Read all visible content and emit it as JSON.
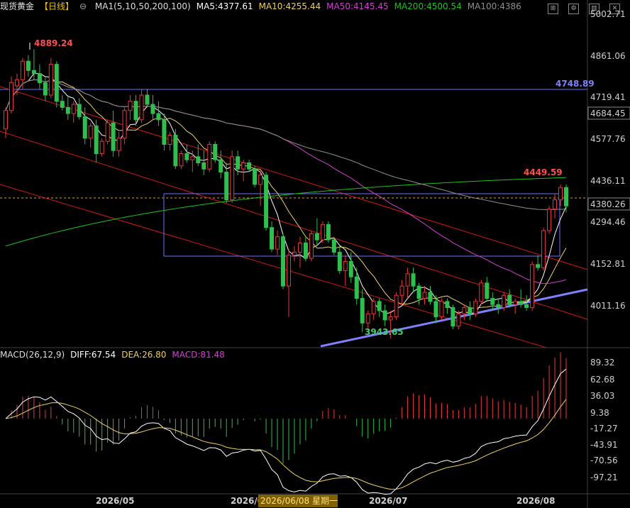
{
  "header": {
    "instrument": "现货黄金",
    "period": "【日线】",
    "ma_title": "MA1(5,10,50,200,100)",
    "ma5": "MA5:4377.61",
    "ma10": "MA10:4255.44",
    "ma50": "MA50:4145.45",
    "ma200": "MA200:4500.54",
    "ma100": "MA100:4386"
  },
  "macd_header": {
    "title": "MACD(26,12,9)",
    "diff": "DIFF:67.54",
    "dea": "DEA:26.80",
    "macd": "MACD:81.48"
  },
  "colors": {
    "up": "#e8383d",
    "down": "#2fbf4f",
    "ma5": "#ffffff",
    "ma10": "#f0d060",
    "ma50": "#d040d0",
    "ma200": "#20c020",
    "ma100": "#909090",
    "channel": "#d01818",
    "rect": "#7070ff",
    "support": "#8888ff"
  },
  "price_axis": {
    "ticks": [
      "5002.71",
      "4861.06",
      "4719.41",
      "4577.76",
      "4436.11",
      "4294.46",
      "4152.81",
      "4011.16"
    ],
    "last_price": "4380.26",
    "level_4684": "4684.45",
    "hline_value": "4748.89"
  },
  "annotations": {
    "high": "4889.24",
    "low": "3943.65",
    "recent_high": "4449.59"
  },
  "macd_axis": {
    "ticks": [
      "89.32",
      "62.68",
      "36.03",
      "9.38",
      "-17.27",
      "-43.91",
      "-70.56",
      "-97.21"
    ]
  },
  "x_axis": {
    "labels": [
      "2026/05",
      "2026/0",
      "2026/07",
      "2026/08"
    ],
    "cursor_label": "2026/06/08 星期一"
  },
  "chart_data": {
    "type": "candlestick",
    "ylim": [
      3920,
      5002.71
    ],
    "candles": [
      [
        4630,
        4700,
        4600,
        4690
      ],
      [
        4690,
        4800,
        4680,
        4780
      ],
      [
        4770,
        4810,
        4740,
        4790
      ],
      [
        4790,
        4860,
        4760,
        4850
      ],
      [
        4850,
        4870,
        4800,
        4820
      ],
      [
        4820,
        4889.24,
        4790,
        4810
      ],
      [
        4810,
        4840,
        4760,
        4780
      ],
      [
        4780,
        4800,
        4720,
        4740
      ],
      [
        4740,
        4860,
        4730,
        4840
      ],
      [
        4840,
        4850,
        4700,
        4720
      ],
      [
        4720,
        4740,
        4690,
        4700
      ],
      [
        4700,
        4740,
        4660,
        4680
      ],
      [
        4680,
        4720,
        4650,
        4710
      ],
      [
        4710,
        4730,
        4660,
        4670
      ],
      [
        4670,
        4700,
        4580,
        4600
      ],
      [
        4600,
        4650,
        4570,
        4640
      ],
      [
        4640,
        4660,
        4520,
        4550
      ],
      [
        4550,
        4600,
        4540,
        4590
      ],
      [
        4590,
        4660,
        4580,
        4650
      ],
      [
        4650,
        4690,
        4540,
        4560
      ],
      [
        4560,
        4620,
        4540,
        4600
      ],
      [
        4600,
        4700,
        4580,
        4690
      ],
      [
        4690,
        4740,
        4660,
        4720
      ],
      [
        4720,
        4740,
        4640,
        4660
      ],
      [
        4660,
        4760,
        4650,
        4740
      ],
      [
        4740,
        4760,
        4700,
        4710
      ],
      [
        4710,
        4740,
        4660,
        4680
      ],
      [
        4680,
        4720,
        4640,
        4660
      ],
      [
        4660,
        4680,
        4560,
        4580
      ],
      [
        4580,
        4620,
        4560,
        4610
      ],
      [
        4610,
        4630,
        4500,
        4510
      ],
      [
        4510,
        4560,
        4500,
        4550
      ],
      [
        4550,
        4580,
        4520,
        4530
      ],
      [
        4530,
        4560,
        4490,
        4540
      ],
      [
        4540,
        4580,
        4510,
        4520
      ],
      [
        4520,
        4560,
        4480,
        4500
      ],
      [
        4500,
        4590,
        4490,
        4580
      ],
      [
        4580,
        4590,
        4520,
        4530
      ],
      [
        4530,
        4560,
        4470,
        4490
      ],
      [
        4490,
        4520,
        4390,
        4400
      ],
      [
        4400,
        4560,
        4390,
        4540
      ],
      [
        4540,
        4560,
        4480,
        4500
      ],
      [
        4500,
        4530,
        4460,
        4520
      ],
      [
        4520,
        4530,
        4490,
        4500
      ],
      [
        4500,
        4510,
        4440,
        4450
      ],
      [
        4450,
        4500,
        4380,
        4480
      ],
      [
        4480,
        4490,
        4300,
        4310
      ],
      [
        4310,
        4330,
        4230,
        4240
      ],
      [
        4240,
        4300,
        4220,
        4280
      ],
      [
        4280,
        4290,
        4110,
        4120
      ],
      [
        4120,
        4240,
        4020,
        4220
      ],
      [
        4220,
        4250,
        4200,
        4230
      ],
      [
        4230,
        4280,
        4180,
        4260
      ],
      [
        4260,
        4280,
        4200,
        4210
      ],
      [
        4210,
        4300,
        4200,
        4290
      ],
      [
        4290,
        4340,
        4250,
        4270
      ],
      [
        4270,
        4330,
        4260,
        4320
      ],
      [
        4320,
        4330,
        4260,
        4270
      ],
      [
        4270,
        4280,
        4220,
        4230
      ],
      [
        4230,
        4250,
        4160,
        4170
      ],
      [
        4170,
        4220,
        4120,
        4200
      ],
      [
        4200,
        4230,
        4130,
        4150
      ],
      [
        4150,
        4180,
        4060,
        4080
      ],
      [
        4080,
        4110,
        3970,
        4000
      ],
      [
        4000,
        4040,
        3980,
        4030
      ],
      [
        4030,
        4080,
        4010,
        4070
      ],
      [
        4070,
        4080,
        4020,
        4040
      ],
      [
        4040,
        4060,
        3990,
        4010
      ],
      [
        4010,
        4040,
        3950,
        4020
      ],
      [
        4020,
        4100,
        4010,
        4090
      ],
      [
        4090,
        4140,
        4060,
        4120
      ],
      [
        4120,
        4180,
        4080,
        4160
      ],
      [
        4160,
        4180,
        4100,
        4120
      ],
      [
        4120,
        4130,
        4060,
        4080
      ],
      [
        4080,
        4120,
        4060,
        4100
      ],
      [
        4100,
        4120,
        4060,
        4070
      ],
      [
        4070,
        4090,
        4000,
        4020
      ],
      [
        4020,
        4080,
        4010,
        4070
      ],
      [
        4070,
        4080,
        4030,
        4050
      ],
      [
        4050,
        4060,
        3980,
        3990
      ],
      [
        3990,
        4040,
        3980,
        4030
      ],
      [
        4030,
        4060,
        4010,
        4050
      ],
      [
        4050,
        4070,
        4010,
        4030
      ],
      [
        4030,
        4080,
        4020,
        4070
      ],
      [
        4070,
        4140,
        4060,
        4130
      ],
      [
        4130,
        4150,
        4070,
        4080
      ],
      [
        4080,
        4100,
        4040,
        4060
      ],
      [
        4060,
        4080,
        4030,
        4050
      ],
      [
        4050,
        4100,
        4040,
        4090
      ],
      [
        4090,
        4110,
        4050,
        4060
      ],
      [
        4060,
        4080,
        4030,
        4070
      ],
      [
        4070,
        4110,
        4050,
        4060
      ],
      [
        4060,
        4090,
        4040,
        4050
      ],
      [
        4050,
        4200,
        4040,
        4190
      ],
      [
        4190,
        4220,
        4170,
        4180
      ],
      [
        4180,
        4310,
        4170,
        4300
      ],
      [
        4300,
        4380,
        4290,
        4370
      ],
      [
        4370,
        4420,
        4340,
        4400
      ],
      [
        4400,
        4449.59,
        4380,
        4440
      ],
      [
        4440,
        4449.59,
        4360,
        4380.26
      ]
    ]
  }
}
